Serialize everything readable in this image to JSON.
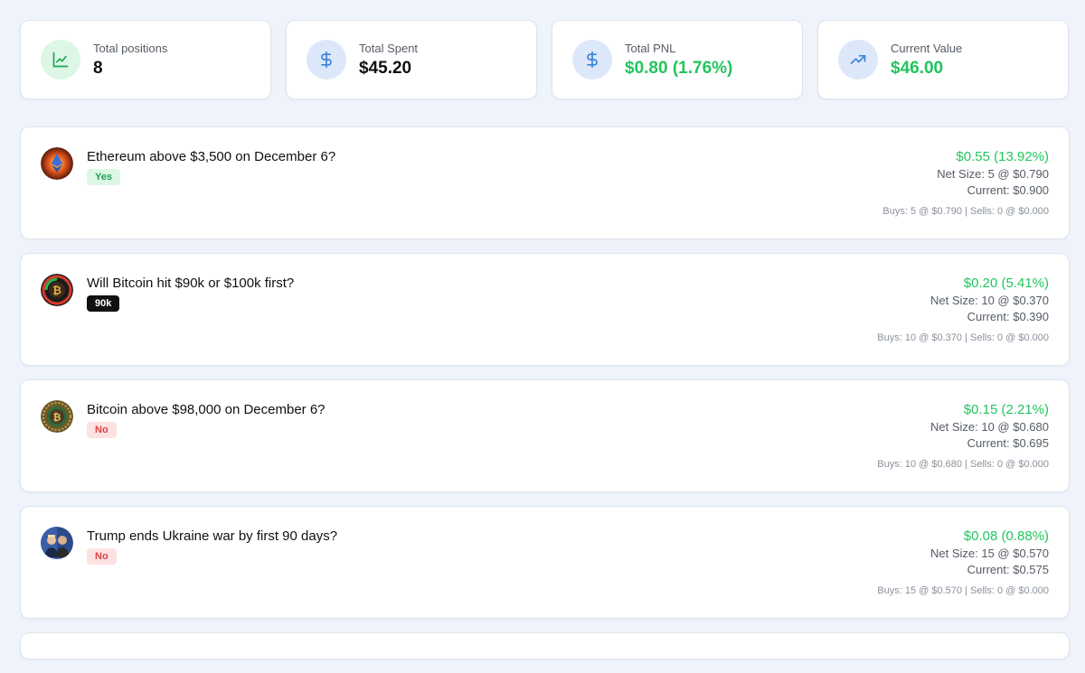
{
  "stats": [
    {
      "label": "Total positions",
      "value": "8",
      "icon": "line-chart-icon"
    },
    {
      "label": "Total Spent",
      "value": "$45.20",
      "icon": "dollar-icon"
    },
    {
      "label": "Total PNL",
      "value": "$0.80 (1.76%)",
      "icon": "dollar-icon"
    },
    {
      "label": "Current Value",
      "value": "$46.00",
      "icon": "trending-up-icon"
    }
  ],
  "colors": {
    "positive": "#22c55e",
    "background": "#eef3fc",
    "green_tint": "#dcf7e6",
    "blue_tint": "#dce8fa",
    "icon_blue": "#3b82d6"
  },
  "positions": [
    {
      "title": "Ethereum above $3,500 on December 6?",
      "outcome": "Yes",
      "pnl": "$0.55 (13.92%)",
      "net_size": "Net Size: 5 @ $0.790",
      "current": "Current: $0.900",
      "trades": "Buys: 5 @ $0.790 | Sells: 0 @ $0.000",
      "avatar": "ethereum-avatar"
    },
    {
      "title": "Will Bitcoin hit $90k or $100k first?",
      "outcome": "90k",
      "pnl": "$0.20 (5.41%)",
      "net_size": "Net Size: 10 @ $0.370",
      "current": "Current: $0.390",
      "trades": "Buys: 10 @ $0.370 | Sells: 0 @ $0.000",
      "avatar": "bitcoin-avatar"
    },
    {
      "title": "Bitcoin above $98,000 on December 6?",
      "outcome": "No",
      "pnl": "$0.15 (2.21%)",
      "net_size": "Net Size: 10 @ $0.680",
      "current": "Current: $0.695",
      "trades": "Buys: 10 @ $0.680 | Sells: 0 @ $0.000",
      "avatar": "bitcoin-coin-avatar"
    },
    {
      "title": "Trump ends Ukraine war by first 90 days?",
      "outcome": "No",
      "pnl": "$0.08 (0.88%)",
      "net_size": "Net Size: 15 @ $0.570",
      "current": "Current: $0.575",
      "trades": "Buys: 15 @ $0.570 | Sells: 0 @ $0.000",
      "avatar": "people-avatar"
    }
  ]
}
